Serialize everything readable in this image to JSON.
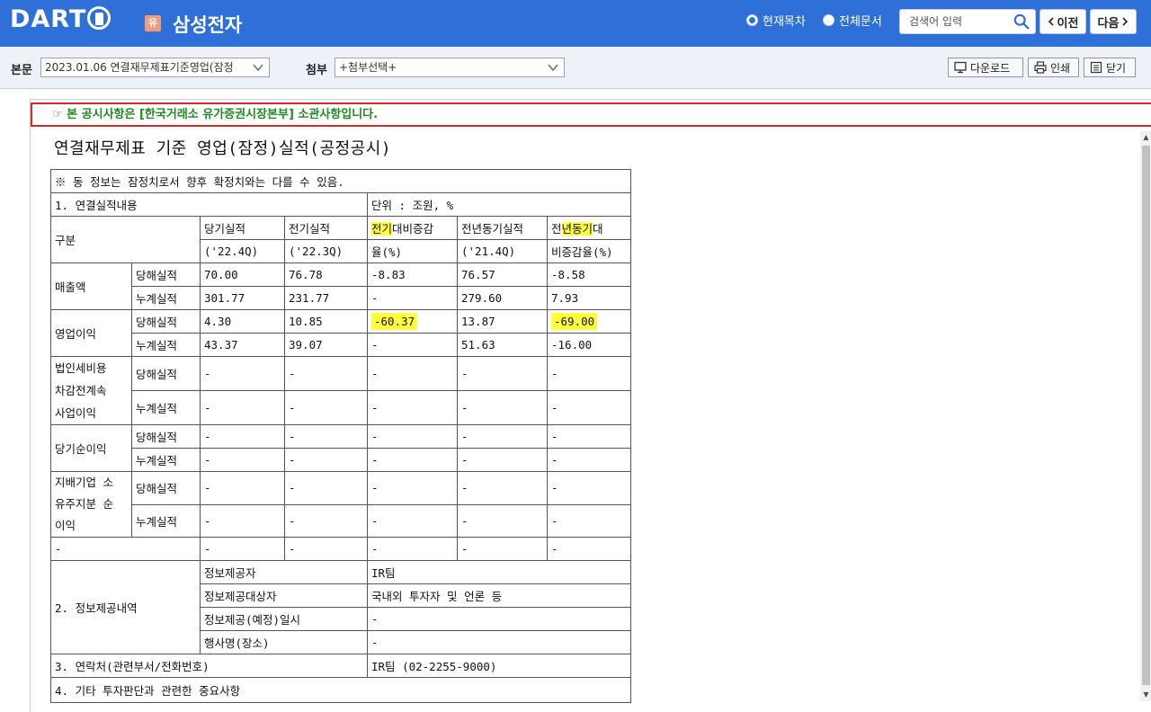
{
  "header": {
    "logo_text": "DART",
    "corp_badge": "유",
    "corp_name": "삼성전자",
    "radio_current": "현재목차",
    "radio_all": "전체문서",
    "search_placeholder": "검색어 입력",
    "prev_label": "이전",
    "next_label": "다음"
  },
  "toolbar": {
    "main_label": "본문",
    "main_select": "2023.01.06  연결재무제표기준영업(잠정",
    "attach_label": "첨부",
    "attach_select": "+첨부선택+",
    "download_label": "다운로드",
    "print_label": "인쇄",
    "close_label": "닫기"
  },
  "notice": "☞ 본 공시사항은 [한국거래소 유가증권시장본부] 소관사항입니다.",
  "doc_title": "연결재무제표 기준 영업(잠정)실적(공정공시)",
  "table": {
    "disclaimer": "※ 동 정보는 잠정치로서 향후 확정치와는 다를 수 있음.",
    "section1": "1. 연결실적내용",
    "unit": "단위 : 조원, %",
    "col_group": "구분",
    "col_cur": "당기실적",
    "col_cur_sub": "('22.4Q)",
    "col_prev": "전기실적",
    "col_prev_sub": "('22.3Q)",
    "col_qoq_a": "전기",
    "col_qoq_b": "대비증감",
    "col_qoq_c": "율(%)",
    "col_yoy": "전년동기실적",
    "col_yoy_sub": "('21.4Q)",
    "col_yoyr_a": "전",
    "col_yoyr_b": "년",
    "col_yoyr_c": "동기",
    "col_yoyr_d": "대",
    "col_yoyr_e": "비증감율(%)",
    "rows": [
      {
        "group": "매출액",
        "type": "당해실적",
        "cur": "70.00",
        "prev": "76.78",
        "qoq": "-8.83",
        "yoy": "76.57",
        "yoyr": "-8.58"
      },
      {
        "type": "누계실적",
        "cur": "301.77",
        "prev": "231.77",
        "qoq": "-",
        "yoy": "279.60",
        "yoyr": "7.93"
      },
      {
        "group": "영업이익",
        "type": "당해실적",
        "cur": "4.30",
        "prev": "10.85",
        "qoq": "-60.37",
        "yoy": "13.87",
        "yoyr": "-69.00"
      },
      {
        "type": "누계실적",
        "cur": "43.37",
        "prev": "39.07",
        "qoq": "-",
        "yoy": "51.63",
        "yoyr": "-16.00"
      },
      {
        "group_a": "법인세비용",
        "group_b": "차감전계속",
        "group_c": "사업이익",
        "type": "당해실적",
        "cur": "-",
        "prev": "-",
        "qoq": "-",
        "yoy": "-",
        "yoyr": "-"
      },
      {
        "type": "누계실적",
        "cur": "-",
        "prev": "-",
        "qoq": "-",
        "yoy": "-",
        "yoyr": "-"
      },
      {
        "group": "당기순이익",
        "type": "당해실적",
        "cur": "-",
        "prev": "-",
        "qoq": "-",
        "yoy": "-",
        "yoyr": "-"
      },
      {
        "type": "누계실적",
        "cur": "-",
        "prev": "-",
        "qoq": "-",
        "yoy": "-",
        "yoyr": "-"
      },
      {
        "group_a": "지배기업 소",
        "group_b": "유주지분 순",
        "group_c": "이익",
        "type": "당해실적",
        "cur": "-",
        "prev": "-",
        "qoq": "-",
        "yoy": "-",
        "yoyr": "-"
      },
      {
        "type": "누계실적",
        "cur": "-",
        "prev": "-",
        "qoq": "-",
        "yoy": "-",
        "yoyr": "-"
      },
      {
        "group": "-",
        "cur": "-",
        "prev": "-",
        "qoq": "-",
        "yoy": "-",
        "yoyr": "-"
      }
    ],
    "section2": "2. 정보제공내역",
    "info_provider_label": "정보제공자",
    "info_provider": "IR팀",
    "info_target_label": "정보제공대상자",
    "info_target": "국내외 투자자 및 언론 등",
    "info_date_label": "정보제공(예정)일시",
    "info_date": "-",
    "info_event_label": "행사명(장소)",
    "info_event": "-",
    "section3": "3. 연락처(관련부서/전화번호)",
    "contact": "IR팀 (02-2255-9000)",
    "section4": "4. 기타 투자판단과 관련한 중요사항"
  },
  "colors": {
    "header_blue": "#2f6fd8",
    "highlight": "#ffff3a",
    "notice_green": "#1f8a1f",
    "notice_border": "#d62a2a"
  }
}
